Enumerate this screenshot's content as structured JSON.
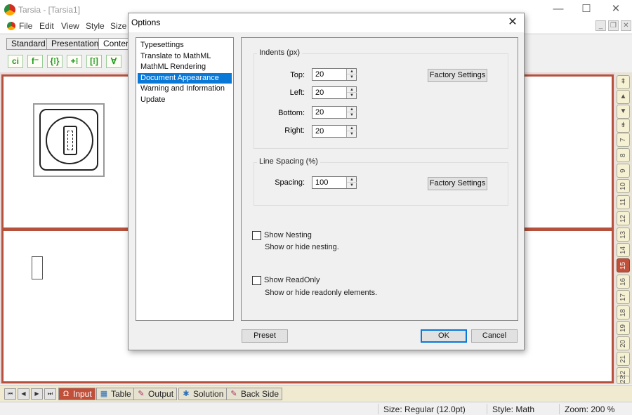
{
  "app": {
    "title": "Tarsia - [Tarsia1]",
    "window_controls": {
      "minimize": "—",
      "maximize": "☐",
      "close": "✕"
    },
    "mdi_controls": {
      "minimize": "_",
      "restore": "❐",
      "close": "✕"
    }
  },
  "menu": [
    "File",
    "Edit",
    "View",
    "Style",
    "Size"
  ],
  "toolbar": {
    "tabs": [
      "Standard",
      "Presentation",
      "Content"
    ],
    "buttons": [
      "ci",
      "f⁻",
      "{⁝}",
      "+⁝",
      "[⁝]",
      "∀"
    ]
  },
  "sidebar": {
    "nav": [
      "⇞",
      "▲",
      "▼",
      "⇟"
    ],
    "numbers": [
      "7",
      "8",
      "9",
      "10",
      "11",
      "12",
      "13",
      "14",
      "15",
      "16",
      "17",
      "18",
      "19",
      "20",
      "21",
      "22",
      "23"
    ],
    "active": "15"
  },
  "bottom_tabs": {
    "nav": [
      "⏮",
      "◀",
      "▶",
      "⏭"
    ],
    "tabs": [
      {
        "label": "Input",
        "icon": "Ω"
      },
      {
        "label": "Table",
        "icon": "▦"
      },
      {
        "label": "Output",
        "icon": "✎"
      },
      {
        "label": "Solution",
        "icon": "✱"
      },
      {
        "label": "Back Side",
        "icon": "✎"
      }
    ]
  },
  "status": {
    "size": "Size: Regular (12.0pt)",
    "style": "Style: Math",
    "zoom": "Zoom: 200 %"
  },
  "dialog": {
    "title": "Options",
    "close": "✕",
    "nav": [
      "Typesettings",
      "Translate to MathML",
      "MathML Rendering",
      "Document Appearance",
      "Warning and Information",
      "Update"
    ],
    "selected_nav": "Document Appearance",
    "indents": {
      "label": "Indents (px)",
      "top_label": "Top:",
      "top": "20",
      "left_label": "Left:",
      "left": "20",
      "bottom_label": "Bottom:",
      "bottom": "20",
      "right_label": "Right:",
      "right": "20",
      "factory": "Factory Settings"
    },
    "line_spacing": {
      "label": "Line Spacing (%)",
      "spacing_label": "Spacing:",
      "spacing": "100",
      "factory": "Factory Settings"
    },
    "show_nesting": {
      "label": "Show Nesting",
      "desc": "Show or hide nesting.",
      "checked": false
    },
    "show_readonly": {
      "label": "Show ReadOnly",
      "desc": "Show or hide readonly elements.",
      "checked": false
    },
    "buttons": {
      "preset": "Preset",
      "ok": "OK",
      "cancel": "Cancel"
    }
  }
}
